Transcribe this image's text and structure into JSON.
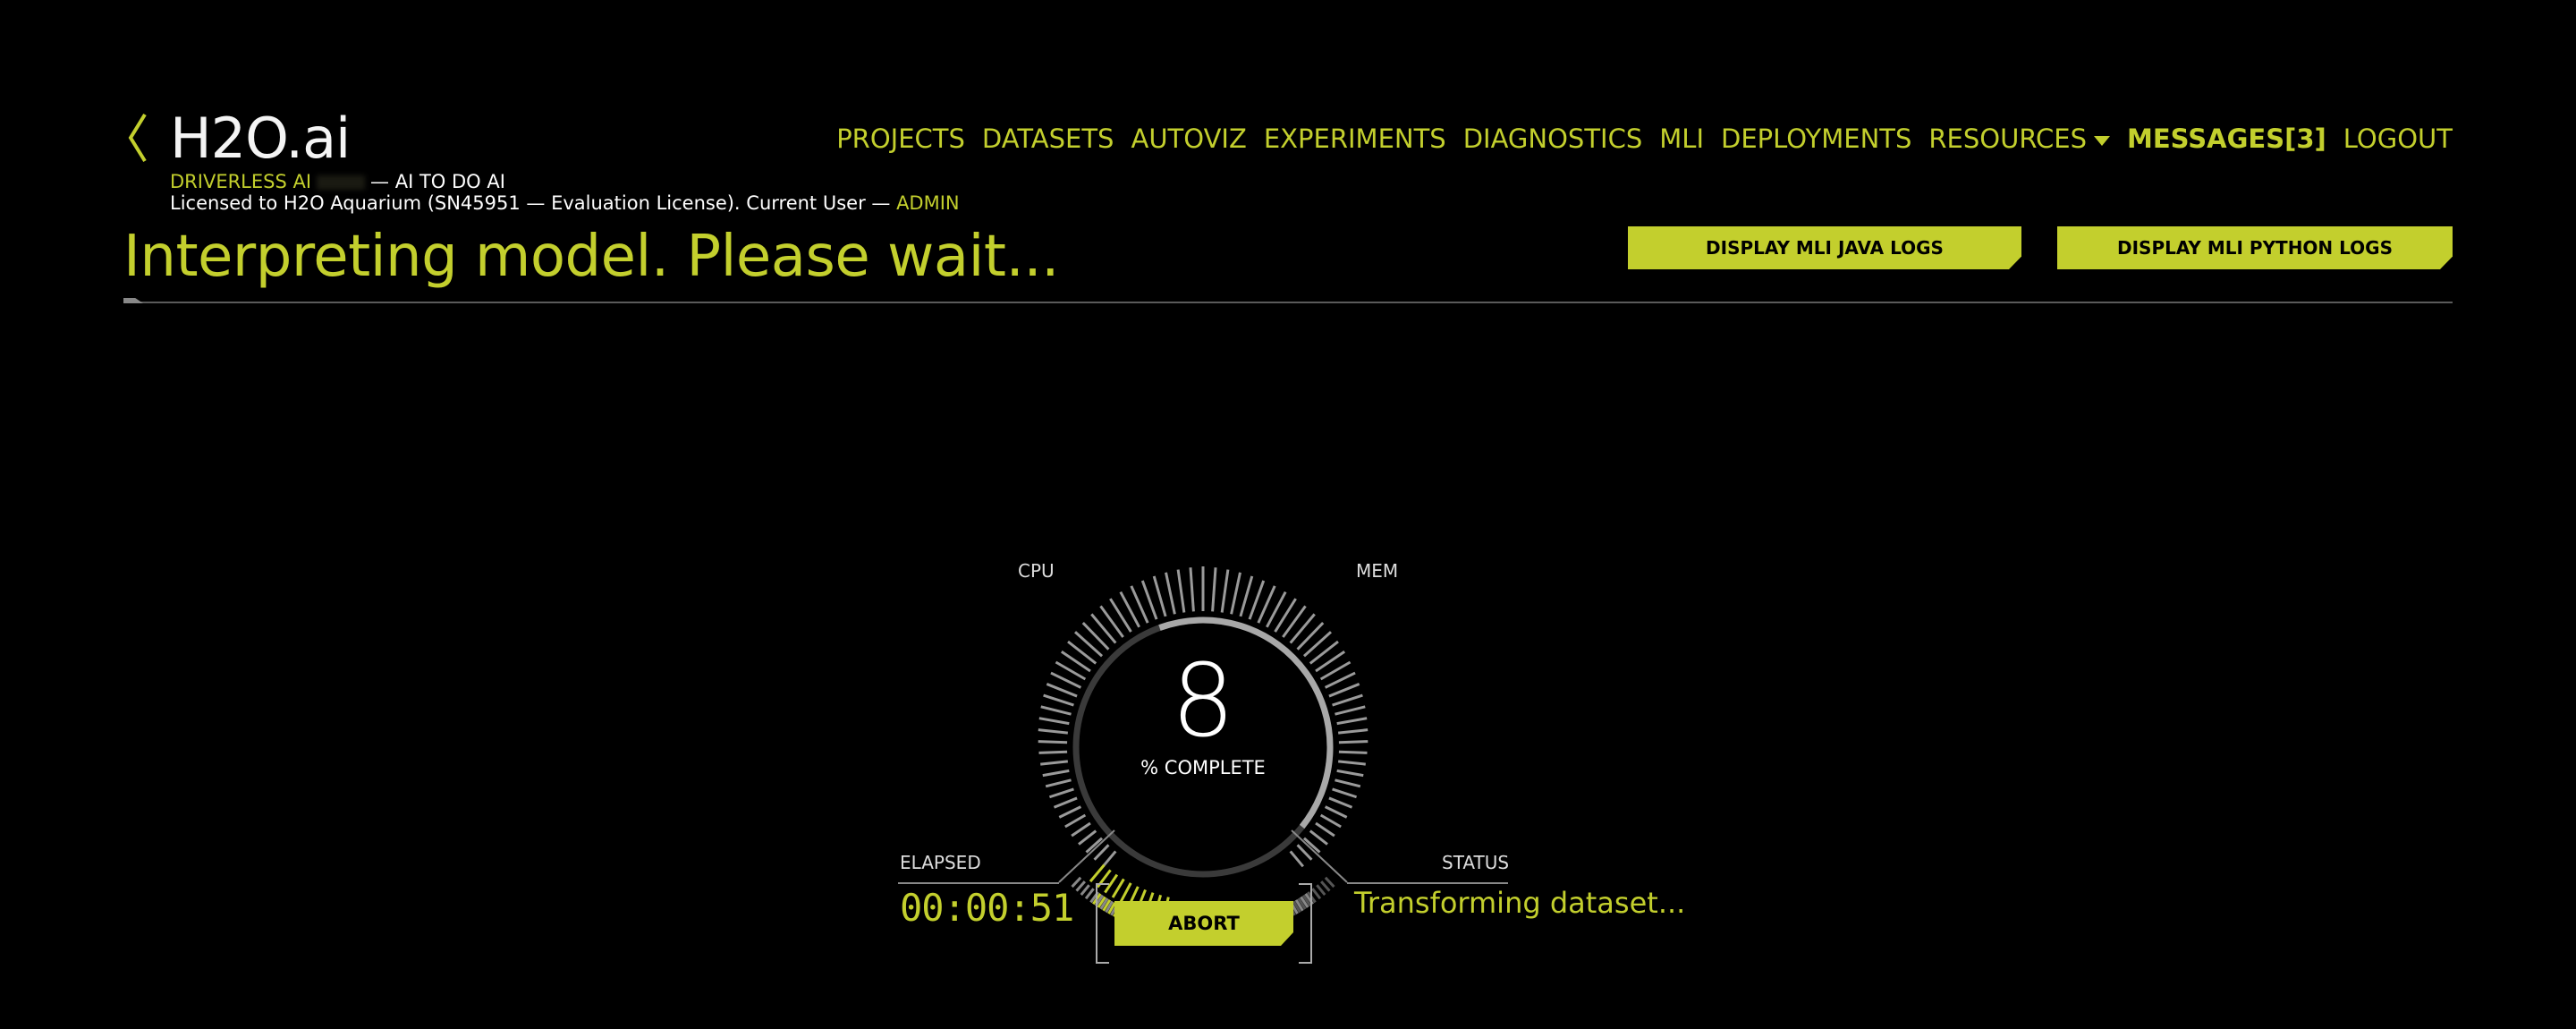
{
  "header": {
    "logo": "H2O.ai",
    "product_name": "DRIVERLESS AI",
    "tagline": "— AI TO DO AI",
    "license_text": "Licensed to H2O Aquarium (SN45951 — Evaluation License). Current User —",
    "current_user": "ADMIN"
  },
  "nav": {
    "items": [
      "PROJECTS",
      "DATASETS",
      "AUTOVIZ",
      "EXPERIMENTS",
      "DIAGNOSTICS",
      "MLI",
      "DEPLOYMENTS",
      "RESOURCES"
    ],
    "messages": "MESSAGES[3]",
    "logout": "LOGOUT"
  },
  "page": {
    "title": "Interpreting model. Please wait...",
    "java_logs_button": "DISPLAY MLI JAVA LOGS",
    "python_logs_button": "DISPLAY MLI PYTHON LOGS"
  },
  "gauge": {
    "cpu_label": "CPU",
    "mem_label": "MEM",
    "percent_complete": "8",
    "percent_label": "% COMPLETE",
    "elapsed_label": "ELAPSED",
    "elapsed_value": "00:00:51",
    "status_label": "STATUS",
    "status_value": "Transforming dataset...",
    "abort_label": "ABORT",
    "cpu_level": 0.22,
    "progress": 0.08
  },
  "colors": {
    "accent": "#c3cf2d",
    "background": "#000000",
    "tick": "#8a8a8a"
  }
}
